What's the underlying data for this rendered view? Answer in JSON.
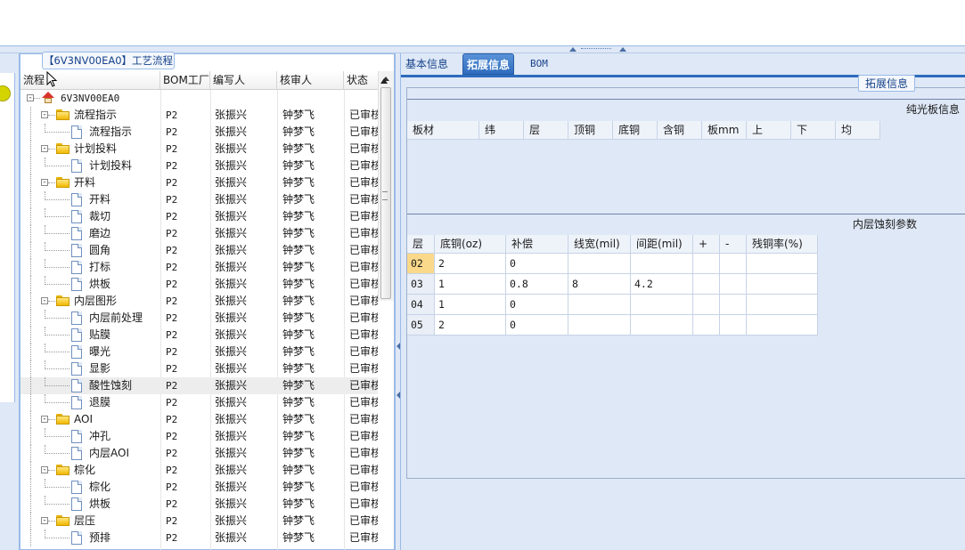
{
  "left_panel": {
    "panel_tab": "【6V3NV00EA0】工艺流程",
    "columns": [
      "流程",
      "BOM工厂",
      "编写人",
      "核审人",
      "状态"
    ],
    "root": "6V3NV00EA0",
    "rows": [
      {
        "name": "流程指示",
        "type": "folder",
        "level": 1,
        "factory": "P2",
        "writer": "张振兴",
        "reviewer": "钟梦飞",
        "status": "已审核"
      },
      {
        "name": "流程指示",
        "type": "doc",
        "level": 2,
        "factory": "P2",
        "writer": "张振兴",
        "reviewer": "钟梦飞",
        "status": "已审核"
      },
      {
        "name": "计划投料",
        "type": "folder",
        "level": 1,
        "factory": "P2",
        "writer": "张振兴",
        "reviewer": "钟梦飞",
        "status": "已审核"
      },
      {
        "name": "计划投料",
        "type": "doc",
        "level": 2,
        "factory": "P2",
        "writer": "张振兴",
        "reviewer": "钟梦飞",
        "status": "已审核"
      },
      {
        "name": "开料",
        "type": "folder",
        "level": 1,
        "factory": "P2",
        "writer": "张振兴",
        "reviewer": "钟梦飞",
        "status": "已审核"
      },
      {
        "name": "开料",
        "type": "doc",
        "level": 2,
        "factory": "P2",
        "writer": "张振兴",
        "reviewer": "钟梦飞",
        "status": "已审核"
      },
      {
        "name": "裁切",
        "type": "doc",
        "level": 2,
        "factory": "P2",
        "writer": "张振兴",
        "reviewer": "钟梦飞",
        "status": "已审核"
      },
      {
        "name": "磨边",
        "type": "doc",
        "level": 2,
        "factory": "P2",
        "writer": "张振兴",
        "reviewer": "钟梦飞",
        "status": "已审核"
      },
      {
        "name": "圆角",
        "type": "doc",
        "level": 2,
        "factory": "P2",
        "writer": "张振兴",
        "reviewer": "钟梦飞",
        "status": "已审核"
      },
      {
        "name": "打标",
        "type": "doc",
        "level": 2,
        "factory": "P2",
        "writer": "张振兴",
        "reviewer": "钟梦飞",
        "status": "已审核"
      },
      {
        "name": "烘板",
        "type": "doc",
        "level": 2,
        "factory": "P2",
        "writer": "张振兴",
        "reviewer": "钟梦飞",
        "status": "已审核"
      },
      {
        "name": "内层图形",
        "type": "folder",
        "level": 1,
        "factory": "P2",
        "writer": "张振兴",
        "reviewer": "钟梦飞",
        "status": "已审核"
      },
      {
        "name": "内层前处理",
        "type": "doc",
        "level": 2,
        "factory": "P2",
        "writer": "张振兴",
        "reviewer": "钟梦飞",
        "status": "已审核"
      },
      {
        "name": "贴膜",
        "type": "doc",
        "level": 2,
        "factory": "P2",
        "writer": "张振兴",
        "reviewer": "钟梦飞",
        "status": "已审核"
      },
      {
        "name": "曝光",
        "type": "doc",
        "level": 2,
        "factory": "P2",
        "writer": "张振兴",
        "reviewer": "钟梦飞",
        "status": "已审核"
      },
      {
        "name": "显影",
        "type": "doc",
        "level": 2,
        "factory": "P2",
        "writer": "张振兴",
        "reviewer": "钟梦飞",
        "status": "已审核"
      },
      {
        "name": "酸性蚀刻",
        "type": "doc",
        "level": 2,
        "factory": "P2",
        "writer": "张振兴",
        "reviewer": "钟梦飞",
        "status": "已审核",
        "selected": true
      },
      {
        "name": "退膜",
        "type": "doc",
        "level": 2,
        "factory": "P2",
        "writer": "张振兴",
        "reviewer": "钟梦飞",
        "status": "已审核"
      },
      {
        "name": "AOI",
        "type": "folder",
        "level": 1,
        "factory": "P2",
        "writer": "张振兴",
        "reviewer": "钟梦飞",
        "status": "已审核"
      },
      {
        "name": "冲孔",
        "type": "doc",
        "level": 2,
        "factory": "P2",
        "writer": "张振兴",
        "reviewer": "钟梦飞",
        "status": "已审核"
      },
      {
        "name": "内层AOI",
        "type": "doc",
        "level": 2,
        "factory": "P2",
        "writer": "张振兴",
        "reviewer": "钟梦飞",
        "status": "已审核"
      },
      {
        "name": "棕化",
        "type": "folder",
        "level": 1,
        "factory": "P2",
        "writer": "张振兴",
        "reviewer": "钟梦飞",
        "status": "已审核"
      },
      {
        "name": "棕化",
        "type": "doc",
        "level": 2,
        "factory": "P2",
        "writer": "张振兴",
        "reviewer": "钟梦飞",
        "status": "已审核"
      },
      {
        "name": "烘板",
        "type": "doc",
        "level": 2,
        "factory": "P2",
        "writer": "张振兴",
        "reviewer": "钟梦飞",
        "status": "已审核"
      },
      {
        "name": "层压",
        "type": "folder",
        "level": 1,
        "factory": "P2",
        "writer": "张振兴",
        "reviewer": "钟梦飞",
        "status": "已审核"
      },
      {
        "name": "预排",
        "type": "doc",
        "level": 2,
        "factory": "P2",
        "writer": "张振兴",
        "reviewer": "钟梦飞",
        "status": "已审核"
      }
    ]
  },
  "right_panel": {
    "tabs": [
      {
        "label": "基本信息",
        "active": false
      },
      {
        "label": "拓展信息",
        "active": true
      },
      {
        "label": "BOM",
        "active": false
      }
    ],
    "fieldset_legend": "拓展信息",
    "upper_section": {
      "title": "纯光板信息",
      "columns": [
        "板材",
        "纬",
        "层",
        "顶铜",
        "底铜",
        "含铜",
        "板mm",
        "上",
        "下",
        "均"
      ]
    },
    "lower_section": {
      "title": "内层蚀刻参数",
      "columns": [
        "层",
        "底铜(oz)",
        "补偿",
        "线宽(mil)",
        "间距(mil)",
        "+",
        "-",
        "残铜率(%)"
      ],
      "rows": [
        {
          "layer": "02",
          "base_cu": "2",
          "comp": "0",
          "line_width": "",
          "spacing": "",
          "plus": "",
          "minus": "",
          "residual": "",
          "highlight": true
        },
        {
          "layer": "03",
          "base_cu": "1",
          "comp": "0.8",
          "line_width": "8",
          "spacing": "4.2",
          "plus": "",
          "minus": "",
          "residual": ""
        },
        {
          "layer": "04",
          "base_cu": "1",
          "comp": "0",
          "line_width": "",
          "spacing": "",
          "plus": "",
          "minus": "",
          "residual": ""
        },
        {
          "layer": "05",
          "base_cu": "2",
          "comp": "0",
          "line_width": "",
          "spacing": "",
          "plus": "",
          "minus": "",
          "residual": ""
        }
      ]
    }
  },
  "colors": {
    "panel_bg": "#dfe8f6",
    "border": "#99bbe8",
    "tab_active": "#2e6bbd",
    "highlight_cell": "#fbd98a"
  }
}
